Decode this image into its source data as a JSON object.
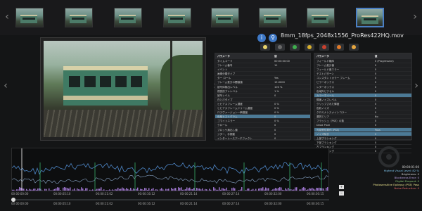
{
  "filmstrip": {
    "thumb_count": 8,
    "active_index": 7
  },
  "title": {
    "filename": "8mm_18fps_2048x1556_ProRes422HQ.mov"
  },
  "colors": {
    "accent": "#4b7fc4",
    "highlight_row": "#4c7a96",
    "info_blue": "#3e78c6",
    "plot_blue": "#4e87c8",
    "plot_purple": "#9a73c9",
    "plot_green": "#39b06a"
  },
  "toolbar": {
    "buttons": [
      {
        "icon": "square-icon",
        "color": "#e8d36a"
      },
      {
        "icon": "cursor-icon",
        "color": "#6a6a6a"
      },
      {
        "icon": "green-dot-icon",
        "color": "#3fae4e"
      },
      {
        "icon": "yellow-dot-icon",
        "color": "#d8b02e"
      },
      {
        "icon": "red-dot-icon",
        "color": "#c8402e"
      },
      {
        "icon": "plus-icon",
        "color": "#e07a2a"
      },
      {
        "icon": "film-icon",
        "color": "#e6a640"
      }
    ]
  },
  "table_left": {
    "headers": [
      "パラメータ",
      "値"
    ],
    "rows": [
      {
        "k": "タイムコード",
        "v": "00:00:00:00"
      },
      {
        "k": "フレーム番号",
        "v": "11"
      },
      {
        "k": "イベント",
        "v": ""
      },
      {
        "k": "画像分類タイプ",
        "v": ""
      },
      {
        "k": "ター ロール",
        "v": "Yes"
      },
      {
        "k": "フレーム差分の閾値値",
        "v": "15.0000"
      },
      {
        "k": "被写体検出レベル",
        "v": "100 %"
      },
      {
        "k": "視覚的ブレレベル",
        "v": "1 %"
      },
      {
        "k": "被写レベル",
        "v": "0"
      },
      {
        "k": "白とびタイプ",
        "v": ""
      },
      {
        "k": "ヒビアスフレーム濃度",
        "v": "0 %"
      },
      {
        "k": "ヒビアスフレームドリーム濃度",
        "v": "0 %"
      },
      {
        "k": "ロスヴァージョン一瞬濃度",
        "v": "0 %"
      },
      {
        "k": "色相ヒストグラム",
        "v": "0",
        "hl": true
      },
      {
        "k": "ゴマイトエラー",
        "v": "0 %"
      },
      {
        "k": "クロール",
        "v": "0"
      },
      {
        "k": "プロッケ無出し値",
        "v": "0"
      },
      {
        "k": "ジター、手振動",
        "v": "0"
      },
      {
        "k": "インターレースアーチファクト",
        "v": "0"
      }
    ]
  },
  "table_right": {
    "headers": [
      "パラメータ",
      "値"
    ],
    "rows": [
      {
        "k": "フィールド順序",
        "v": "0 (Progressive)"
      },
      {
        "k": "フレーム差分値",
        "v": "0"
      },
      {
        "k": "フィールド差エラー",
        "v": "0"
      },
      {
        "k": "テストパターン",
        "v": "0"
      },
      {
        "k": "コンスタントカラー フレーム",
        "v": "0"
      },
      {
        "k": "ピラーボックス",
        "v": "0"
      },
      {
        "k": "レターボックス",
        "v": "0"
      },
      {
        "k": "色域外ピクセル",
        "v": "0"
      },
      {
        "k": "カラーホイール",
        "v": "0",
        "hl": true
      },
      {
        "k": "輝度ノイズレベル",
        "v": "0"
      },
      {
        "k": "クリップされた輝度",
        "v": "0"
      },
      {
        "k": "色彩ノイズ",
        "v": "0"
      },
      {
        "k": "クロミナンスメインコラー",
        "v": "0"
      },
      {
        "k": "選択エリア",
        "v": "No"
      },
      {
        "k": "フラッシュ（PSE）の数",
        "v": "0"
      },
      {
        "k": "Dead Pixel",
        "v": "0"
      },
      {
        "k": "光感受性発作 (PSE)",
        "v": "Pass",
        "hl": true
      },
      {
        "k": "ノイズ除去",
        "v": "0",
        "hl": true
      },
      {
        "k": "上部ブランキング",
        "v": "0"
      },
      {
        "k": "下部ブランキング",
        "v": "0"
      },
      {
        "k": "左ブランキング",
        "v": "0"
      },
      {
        "k": "右ブランキング",
        "v": "0"
      }
    ]
  },
  "timeline": {
    "ruler_top": [
      "00:00:00:00",
      "00:00:05:10",
      "00:00:11:02",
      "00:00:16:12",
      "00:00:21:14",
      "00:00:27:14",
      "00:00:32:00",
      "00:00:36:15"
    ],
    "ruler_bottom": [
      "00:00:00:00",
      "00:00:05:10",
      "00:00:11:02",
      "00:00:16:12",
      "00:00:21:14",
      "00:00:27:14",
      "00:00:32:00",
      "00:00:36:15"
    ]
  },
  "legend": {
    "time": "00:00:01:00",
    "lines": [
      {
        "label": "Highest Visual Level: 82 %",
        "color": "#7cc0e8"
      },
      {
        "label": "Brightness: 0",
        "color": "#d6d6d6"
      },
      {
        "label": "Blockiness Error: 0",
        "color": "#b9a1e3"
      },
      {
        "label": "Digital Dropout: 0",
        "color": "#8bc26f"
      },
      {
        "label": "Photosensitive Epilepsy (PSE) Pass",
        "color": "#e8e08c"
      },
      {
        "label": "Noise Reduction: 0",
        "color": "#e46a6a"
      }
    ]
  }
}
